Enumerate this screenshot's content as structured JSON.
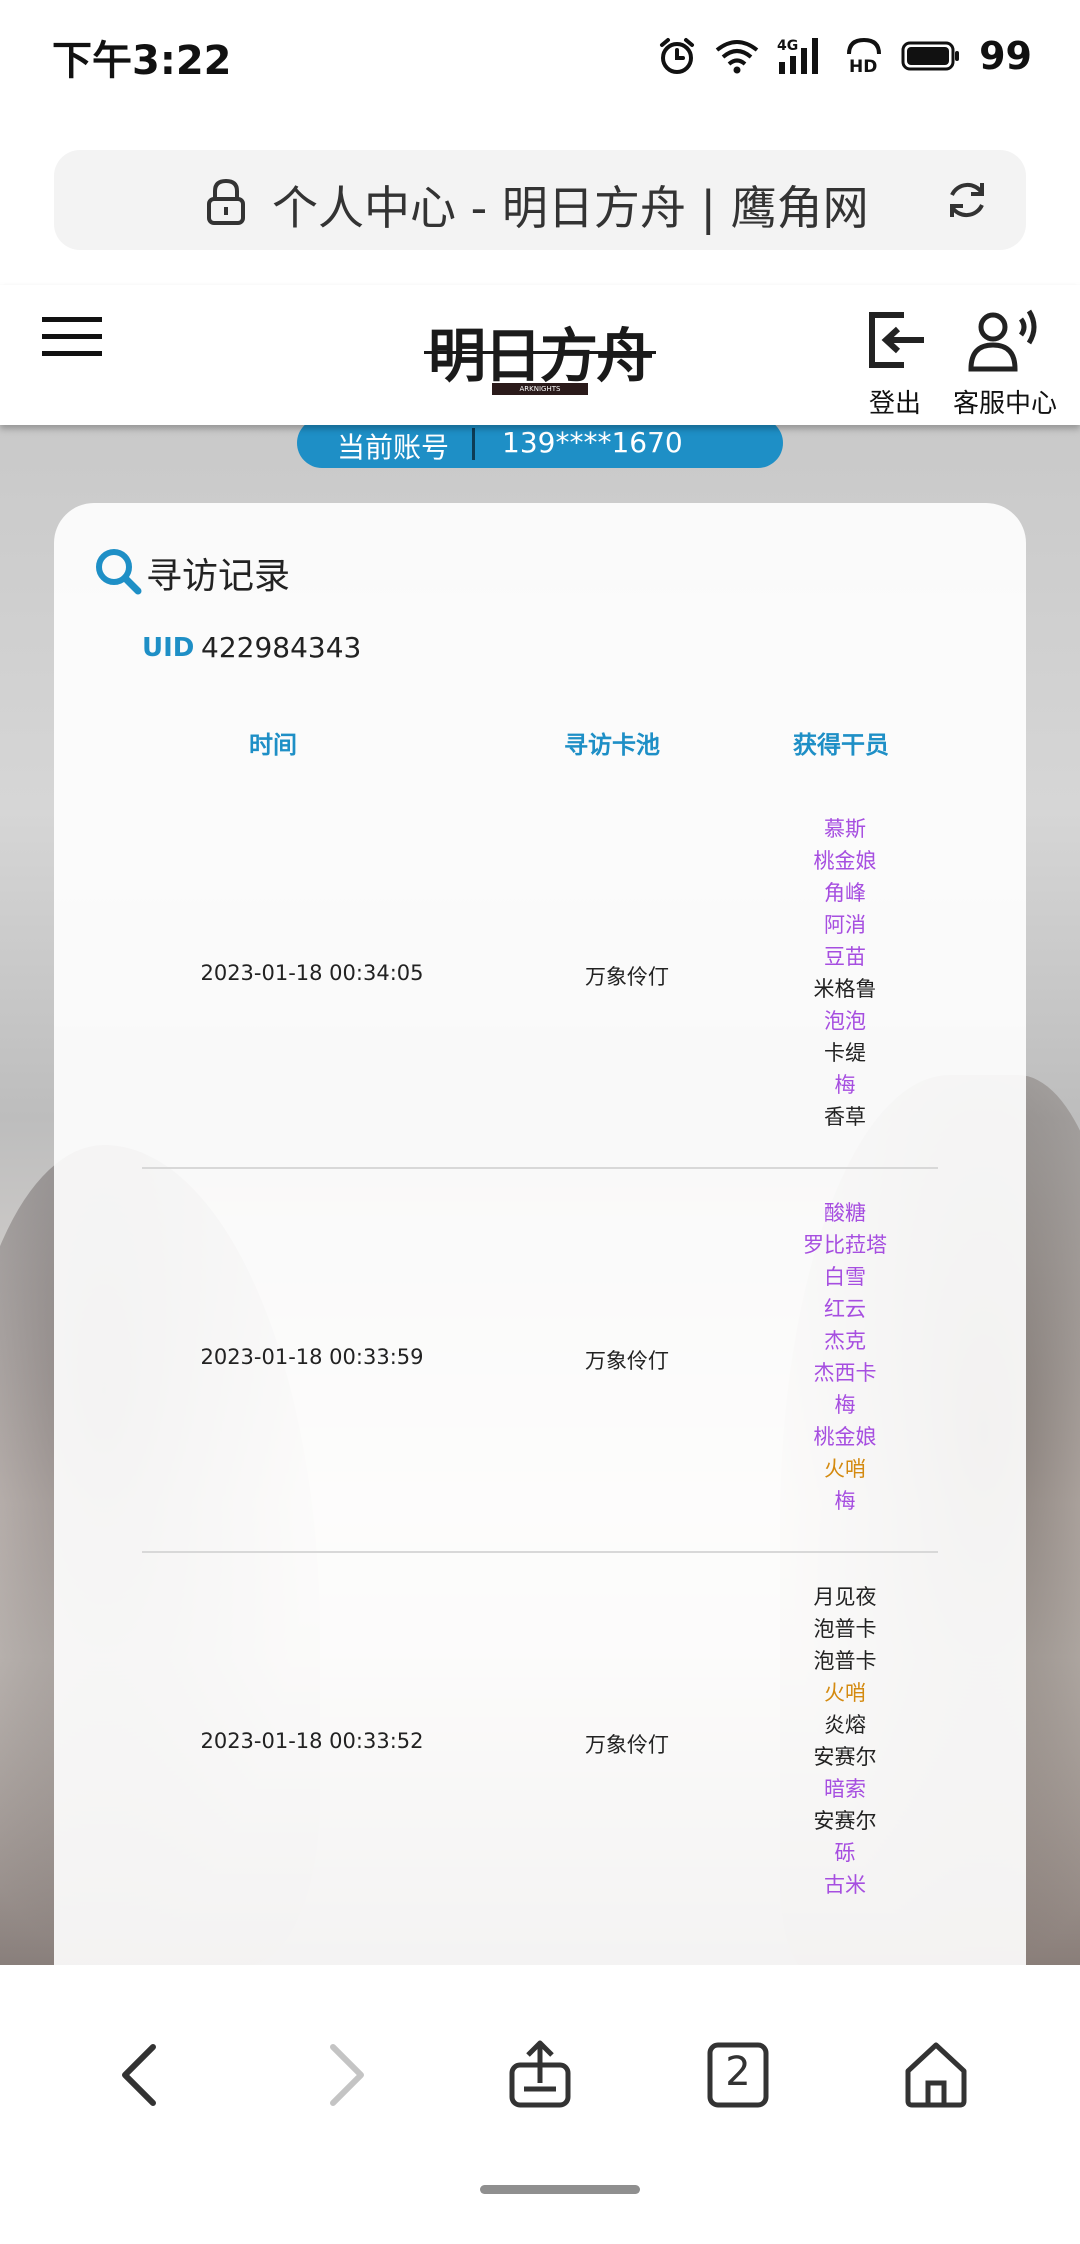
{
  "status_bar": {
    "time": "下午3:22",
    "battery": "99"
  },
  "browser": {
    "page_title": "个人中心 - 明日方舟 | 鹰角网"
  },
  "header": {
    "logo_text": "明日方舟",
    "logo_sub": "ARKNIGHTS",
    "logout_label": "登出",
    "service_label": "客服中心"
  },
  "account": {
    "label": "当前账号",
    "value": "139****1670"
  },
  "records": {
    "title": "寻访记录",
    "uid_label": "UID",
    "uid_value": "422984343",
    "columns": [
      "时间",
      "寻访卡池",
      "获得干员"
    ],
    "rows": [
      {
        "time": "2023-01-18 00:34:05",
        "pool": "万象伶仃",
        "operators": [
          {
            "name": "慕斯",
            "rarity": "purple"
          },
          {
            "name": "桃金娘",
            "rarity": "purple"
          },
          {
            "name": "角峰",
            "rarity": "purple"
          },
          {
            "name": "阿消",
            "rarity": "purple"
          },
          {
            "name": "豆苗",
            "rarity": "purple"
          },
          {
            "name": "米格鲁",
            "rarity": "black"
          },
          {
            "name": "泡泡",
            "rarity": "purple"
          },
          {
            "name": "卡缇",
            "rarity": "black"
          },
          {
            "name": "梅",
            "rarity": "purple"
          },
          {
            "name": "香草",
            "rarity": "black"
          }
        ]
      },
      {
        "time": "2023-01-18 00:33:59",
        "pool": "万象伶仃",
        "operators": [
          {
            "name": "酸糖",
            "rarity": "purple"
          },
          {
            "name": "罗比菈塔",
            "rarity": "purple"
          },
          {
            "name": "白雪",
            "rarity": "purple"
          },
          {
            "name": "红云",
            "rarity": "purple"
          },
          {
            "name": "杰克",
            "rarity": "purple"
          },
          {
            "name": "杰西卡",
            "rarity": "purple"
          },
          {
            "name": "梅",
            "rarity": "purple"
          },
          {
            "name": "桃金娘",
            "rarity": "purple"
          },
          {
            "name": "火哨",
            "rarity": "gold"
          },
          {
            "name": "梅",
            "rarity": "purple"
          }
        ]
      },
      {
        "time": "2023-01-18 00:33:52",
        "pool": "万象伶仃",
        "operators": [
          {
            "name": "月见夜",
            "rarity": "black"
          },
          {
            "name": "泡普卡",
            "rarity": "black"
          },
          {
            "name": "泡普卡",
            "rarity": "black"
          },
          {
            "name": "火哨",
            "rarity": "gold"
          },
          {
            "name": "炎熔",
            "rarity": "black"
          },
          {
            "name": "安赛尔",
            "rarity": "black"
          },
          {
            "name": "暗索",
            "rarity": "purple"
          },
          {
            "name": "安赛尔",
            "rarity": "black"
          },
          {
            "name": "砾",
            "rarity": "purple"
          },
          {
            "name": "古米",
            "rarity": "purple"
          }
        ]
      }
    ]
  },
  "bottom_nav": {
    "tab_count": "2"
  },
  "colors": {
    "accent": "#1e8fc6",
    "rarity_purple": "#a64ee0",
    "rarity_gold": "#d48a10",
    "rarity_black": "#222222"
  }
}
